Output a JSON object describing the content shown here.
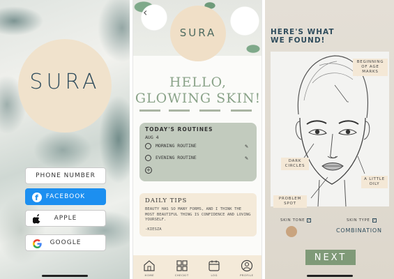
{
  "login": {
    "logo": "SURA",
    "phone_label": "PHONE NUMBER",
    "facebook_label": "FACEBOOK",
    "apple_label": "APPLE",
    "google_label": "GOOGLE",
    "brand_colors": {
      "facebook": "#1c8ff0",
      "logo_circle": "#f0e2cc",
      "logo_text": "#2f4c5c"
    }
  },
  "home": {
    "back_icon": "chevron-left-icon",
    "logo": "SURA",
    "greeting_line1": "HELLO,",
    "greeting_line2": "GLOWING SKIN!",
    "routines": {
      "title": "TODAY'S ROUTINES",
      "date": "AUG 4",
      "items": [
        {
          "label": "MORNING ROUTINE"
        },
        {
          "label": "EVENING ROUTINE"
        }
      ]
    },
    "tips": {
      "title": "DAILY TIPS",
      "quote": "BEAUTY HAS SO MANY FORMS, AND I THINK THE MOST BEAUTIFUL THING IS CONFIDENCE AND LOVING YOURSELF.",
      "author": "-KIESZA"
    },
    "nav": [
      {
        "label": "HOME",
        "icon": "home-icon"
      },
      {
        "label": "CHECKIT",
        "icon": "grid-icon"
      },
      {
        "label": "LOG",
        "icon": "calendar-icon"
      },
      {
        "label": "PROFILE",
        "icon": "profile-icon"
      }
    ],
    "colors": {
      "accent": "#8aa389",
      "routines_bg": "#c2cbbe",
      "tips_bg": "#f4ead9"
    }
  },
  "results": {
    "heading_line1": "Here's what",
    "heading_line2": "we found!",
    "labels": {
      "age_marks": "BEGINNING OF AGE MARKS",
      "dark_circles": "DARK CIRCLES",
      "oily": "A LITTLE OILY",
      "problem_spot": "PROBLEM SPOT"
    },
    "skin_tone_label": "SKIN TONE",
    "skin_type_label": "SKIN TYPE",
    "skin_type_value": "COMBINATION",
    "next_label": "NEXT",
    "colors": {
      "skin_tone": "#c9a47f",
      "next_button": "#7f9a78"
    }
  }
}
